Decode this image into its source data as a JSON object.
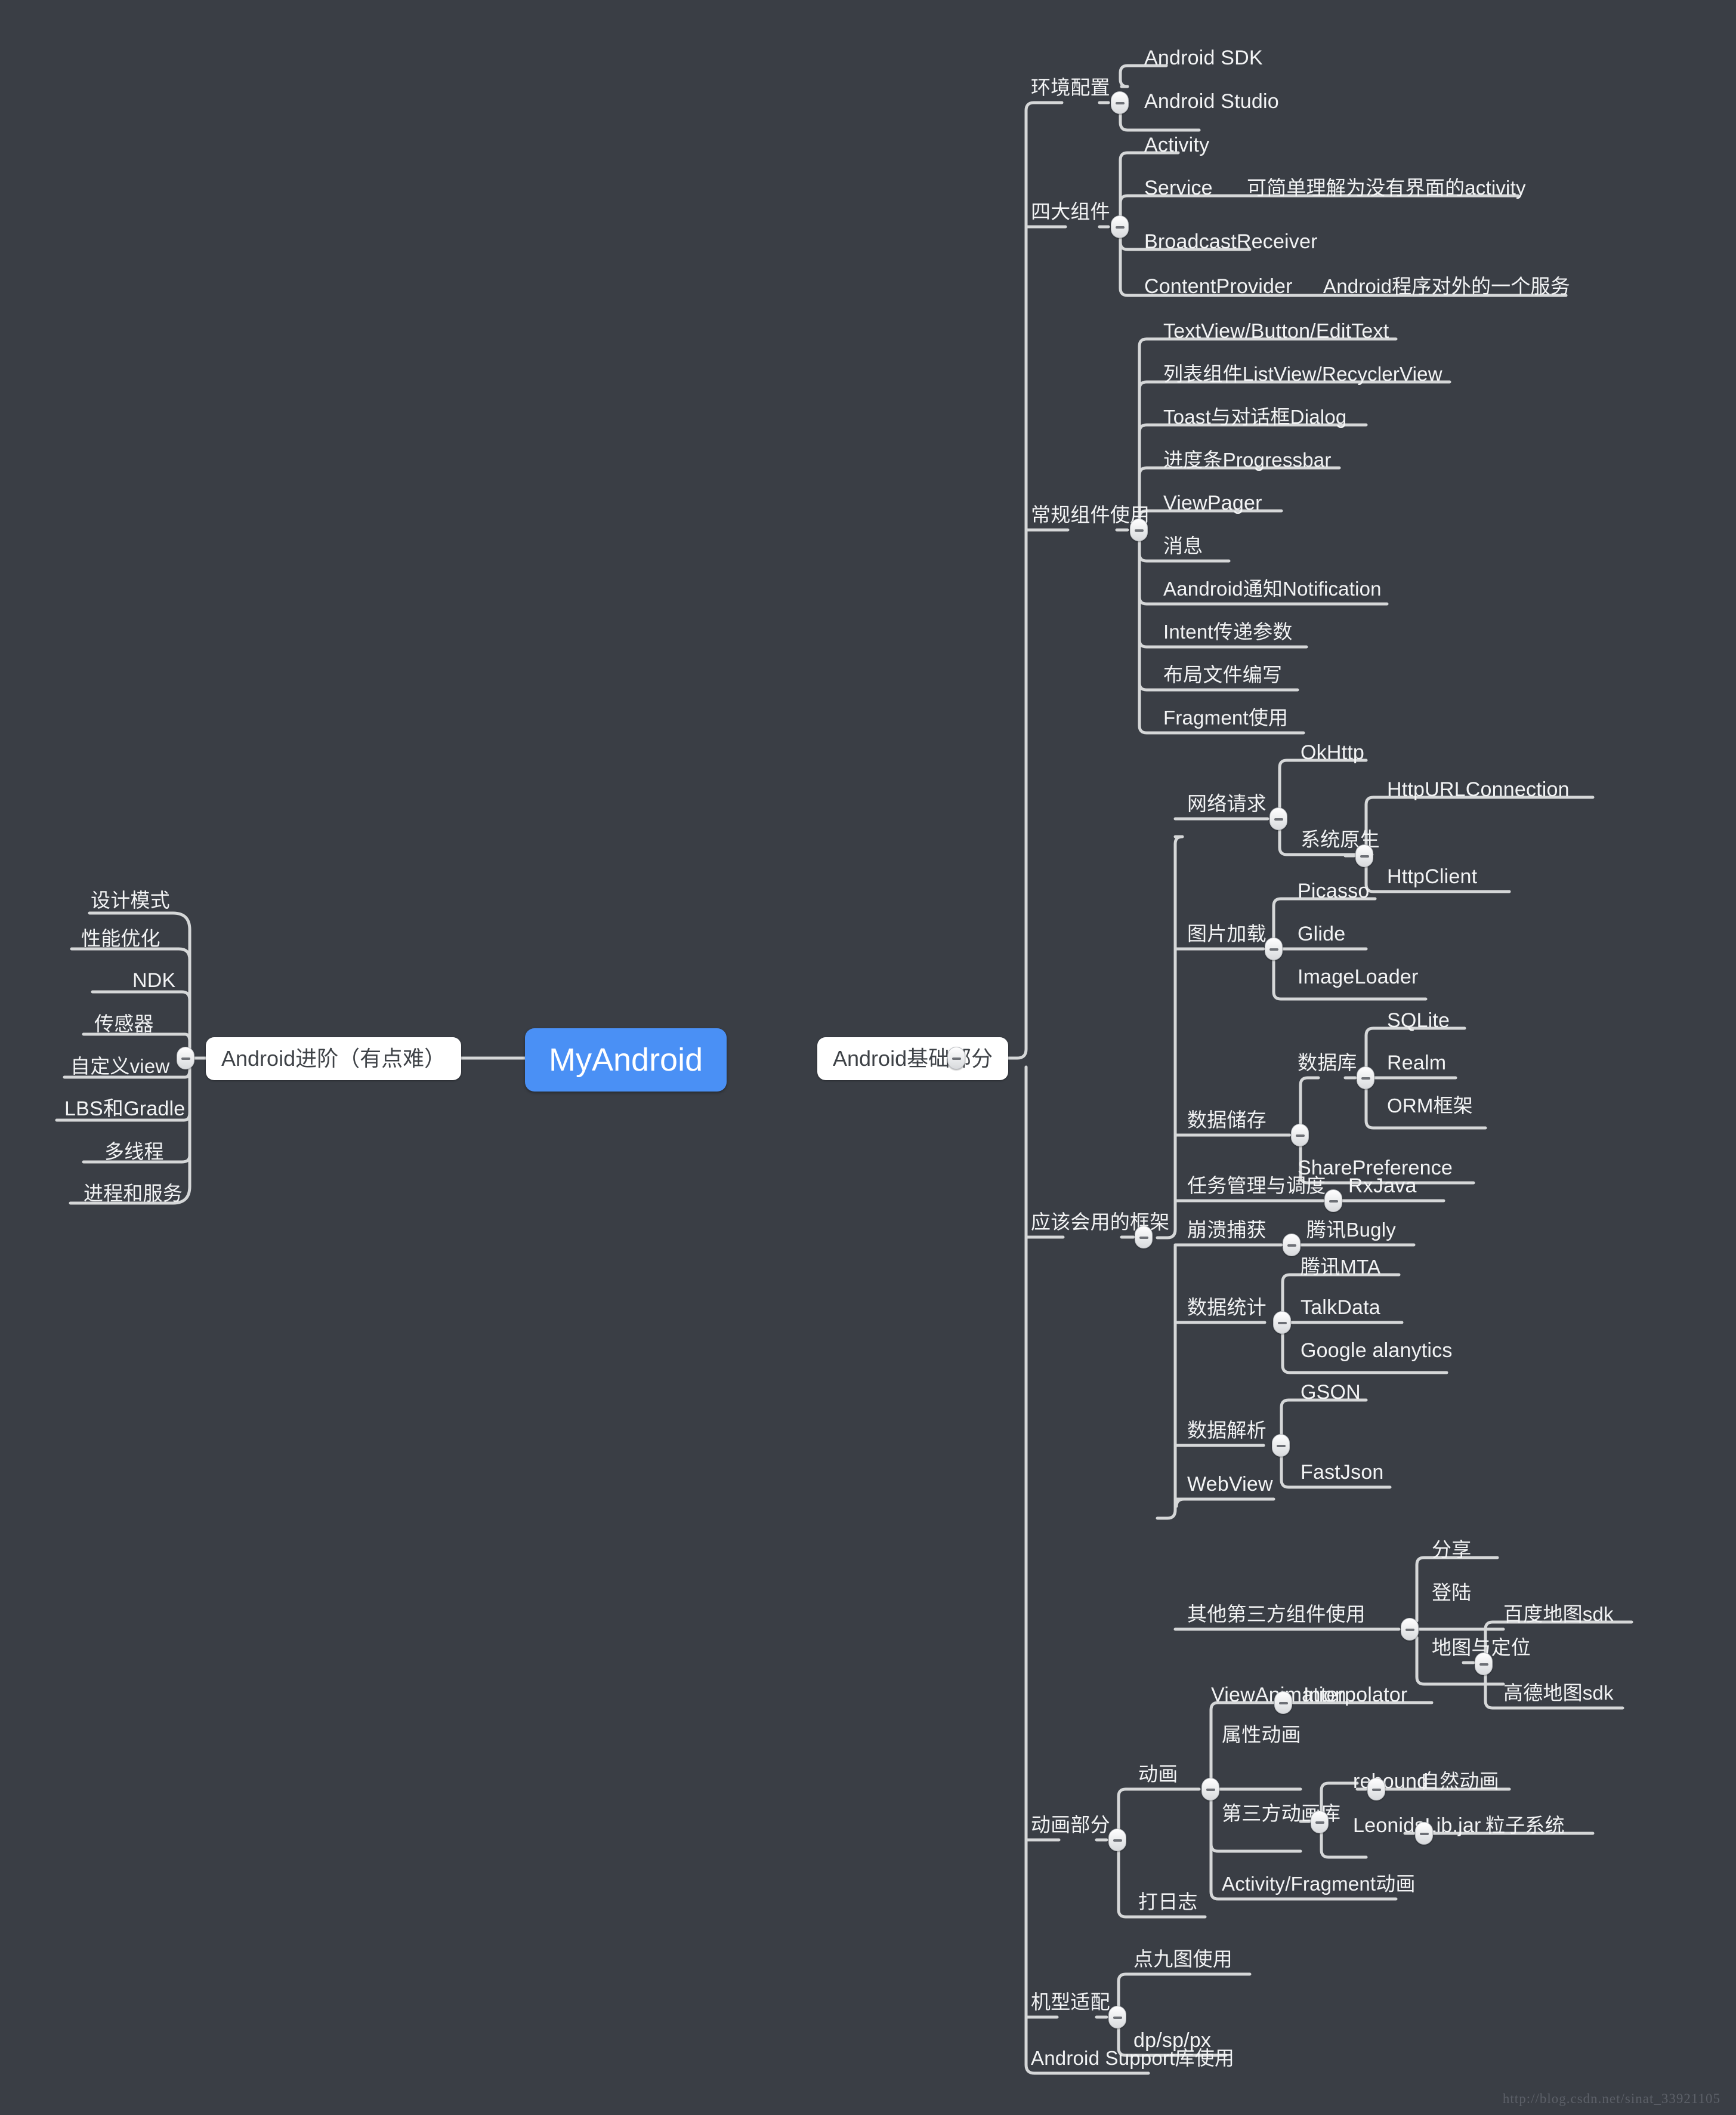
{
  "background_color": "#3a3e45",
  "line_color": "#d5d7d8",
  "root": {
    "label": "MyAndroid",
    "color": "#4a90f5"
  },
  "branches": {
    "left": {
      "label": "Android进阶（有点难）",
      "children": [
        {
          "label": "设计模式"
        },
        {
          "label": "性能优化"
        },
        {
          "label": "NDK"
        },
        {
          "label": "传感器"
        },
        {
          "label": "自定义view"
        },
        {
          "label": "LBS和Gradle"
        },
        {
          "label": "多线程"
        },
        {
          "label": "进程和服务"
        }
      ]
    },
    "right": {
      "label": "Android基础部分",
      "groups": [
        {
          "label": "环境配置",
          "children": [
            {
              "label": "Android SDK"
            },
            {
              "label": "Android  Studio"
            }
          ]
        },
        {
          "label": "四大组件",
          "children": [
            {
              "label": "Activity"
            },
            {
              "label": "Service",
              "note": "可简单理解为没有界面的activity"
            },
            {
              "label": "BroadcastReceiver"
            },
            {
              "label": "ContentProvider",
              "note": "Android程序对外的一个服务"
            }
          ]
        },
        {
          "label": "常规组件使用",
          "children": [
            {
              "label": "TextView/Button/EditText"
            },
            {
              "label": "列表组件ListView/RecyclerView"
            },
            {
              "label": "Toast与对话框Dialog"
            },
            {
              "label": "进度条Progressbar"
            },
            {
              "label": "ViewPager"
            },
            {
              "label": "消息"
            },
            {
              "label": "Aandroid通知Notification"
            },
            {
              "label": "Intent传递参数"
            },
            {
              "label": "布局文件编写"
            },
            {
              "label": "Fragment使用"
            }
          ]
        },
        {
          "label": "应该会用的框架",
          "children": [
            {
              "label": "网络请求",
              "children": [
                {
                  "label": "OkHttp"
                },
                {
                  "label": "系统原生",
                  "children": [
                    {
                      "label": "HttpURLConnection"
                    },
                    {
                      "label": "HttpClient"
                    }
                  ]
                }
              ]
            },
            {
              "label": "图片加载",
              "children": [
                {
                  "label": "Picasso"
                },
                {
                  "label": "Glide"
                },
                {
                  "label": "ImageLoader"
                }
              ]
            },
            {
              "label": "数据储存",
              "children": [
                {
                  "label": "数据库",
                  "children": [
                    {
                      "label": "SQLite"
                    },
                    {
                      "label": "Realm"
                    },
                    {
                      "label": "ORM框架"
                    }
                  ]
                },
                {
                  "label": "SharePreference"
                }
              ]
            },
            {
              "label": "任务管理与调度",
              "children": [
                {
                  "label": "RxJava"
                }
              ]
            },
            {
              "label": "崩溃捕获",
              "children": [
                {
                  "label": "腾讯Bugly"
                }
              ]
            },
            {
              "label": "数据统计",
              "children": [
                {
                  "label": "腾讯MTA"
                },
                {
                  "label": "TalkData"
                },
                {
                  "label": "Google alanytics"
                }
              ]
            },
            {
              "label": "数据解析",
              "children": [
                {
                  "label": "GSON"
                },
                {
                  "label": "FastJson"
                }
              ]
            },
            {
              "label": "WebView"
            },
            {
              "label": "其他第三方组件使用",
              "children": [
                {
                  "label": "分享"
                },
                {
                  "label": "登陆"
                },
                {
                  "label": "地图与定位",
                  "children": [
                    {
                      "label": "百度地图sdk"
                    },
                    {
                      "label": "高德地图sdk"
                    }
                  ]
                }
              ]
            }
          ]
        },
        {
          "label": "动画部分",
          "children": [
            {
              "label": "动画",
              "children": [
                {
                  "label": "ViewAnimation",
                  "children": [
                    {
                      "label": "Interpolator"
                    }
                  ]
                },
                {
                  "label": "属性动画"
                },
                {
                  "label": "第三方动画库",
                  "children": [
                    {
                      "label": "rebound",
                      "children": [
                        {
                          "label": "自然动画"
                        }
                      ]
                    },
                    {
                      "label": "LeonidsLib.jar",
                      "children": [
                        {
                          "label": "粒子系统"
                        }
                      ]
                    }
                  ]
                },
                {
                  "label": "Activity/Fragment动画"
                }
              ]
            },
            {
              "label": "打日志"
            }
          ]
        },
        {
          "label": "机型适配",
          "children": [
            {
              "label": "点九图使用"
            },
            {
              "label": "dp/sp/px"
            }
          ]
        },
        {
          "label": "Android Support库使用"
        }
      ]
    }
  },
  "watermark": "http://blog.csdn.net/sinat_33921105"
}
